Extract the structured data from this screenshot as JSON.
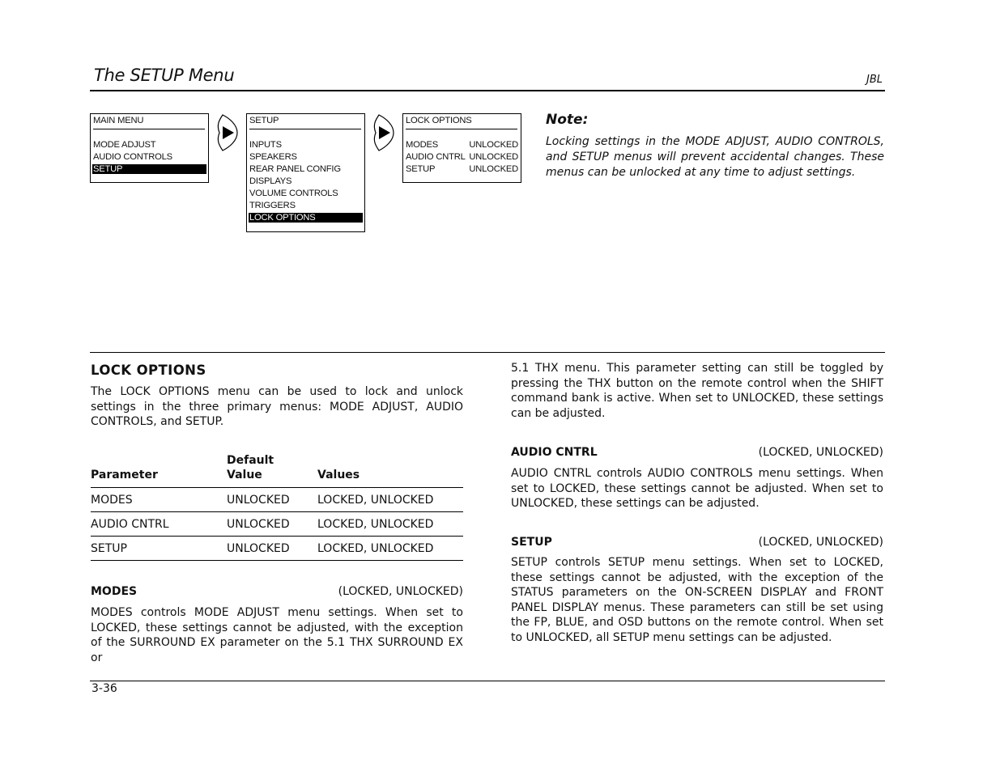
{
  "header": {
    "title": "The SETUP Menu",
    "brand": "JBL"
  },
  "osd_flow": {
    "main_menu": {
      "title": "MAIN MENU",
      "items": [
        "MODE ADJUST",
        "AUDIO CONTROLS",
        "SETUP"
      ],
      "selected": "SETUP"
    },
    "setup_menu": {
      "title": "SETUP",
      "items": [
        "INPUTS",
        "SPEAKERS",
        "REAR PANEL CONFIG",
        "DISPLAYS",
        "VOLUME CONTROLS",
        "TRIGGERS",
        "LOCK OPTIONS"
      ],
      "selected": "LOCK OPTIONS"
    },
    "lock_options_menu": {
      "title": "LOCK OPTIONS",
      "rows": [
        {
          "label": "MODES",
          "value": "UNLOCKED"
        },
        {
          "label": "AUDIO CNTRL",
          "value": "UNLOCKED"
        },
        {
          "label": "SETUP",
          "value": "UNLOCKED"
        }
      ]
    },
    "arrow_icons": [
      "right-arrow-button-icon",
      "right-arrow-button-icon"
    ]
  },
  "note": {
    "heading": "Note:",
    "body": "Locking settings in the MODE ADJUST, AUDIO CONTROLS,  and SETUP menus will prevent accidental changes. These menus can be unlocked at any time to adjust settings."
  },
  "section": {
    "heading": "LOCK OPTIONS",
    "intro": "The LOCK OPTIONS menu can be used to lock and unlock settings in the three primary menus: MODE ADJUST, AUDIO CONTROLS, and SETUP.",
    "table": {
      "headers": [
        "Parameter",
        "Default Value",
        "Values"
      ],
      "header_lines": {
        "default_line1": "Default",
        "default_line2": "Value"
      },
      "rows": [
        [
          "MODES",
          "UNLOCKED",
          "LOCKED, UNLOCKED"
        ],
        [
          "AUDIO CNTRL",
          "UNLOCKED",
          "LOCKED, UNLOCKED"
        ],
        [
          "SETUP",
          "UNLOCKED",
          "LOCKED, UNLOCKED"
        ]
      ]
    },
    "params": [
      {
        "name": "MODES",
        "range": "(LOCKED, UNLOCKED)",
        "body_left": "MODES controls MODE ADJUST menu settings. When set to LOCKED, these settings cannot be adjusted, with the exception of the SURROUND EX parameter on the 5.1 THX SURROUND EX or",
        "body_right": "5.1 THX menu. This parameter setting can still be toggled by pressing the THX button on the remote control when the SHIFT command bank is active. When set to UNLOCKED, these settings can be adjusted."
      },
      {
        "name": "AUDIO CNTRL",
        "range": "(LOCKED, UNLOCKED)",
        "body": "AUDIO CNTRL controls AUDIO CONTROLS menu settings. When set to LOCKED, these settings cannot be adjusted. When set to UNLOCKED, these settings can be adjusted."
      },
      {
        "name": "SETUP",
        "range": "(LOCKED, UNLOCKED)",
        "body": "SETUP controls SETUP menu settings. When set to LOCKED, these settings cannot be adjusted, with the exception of the STATUS parameters on the ON-SCREEN DISPLAY and FRONT PANEL DISPLAY menus. These parameters can still be set using the FP, BLUE, and OSD buttons on the remote control. When set to UNLOCKED, all SETUP menu settings can be adjusted."
      }
    ]
  },
  "footer": {
    "page_number": "3-36"
  }
}
